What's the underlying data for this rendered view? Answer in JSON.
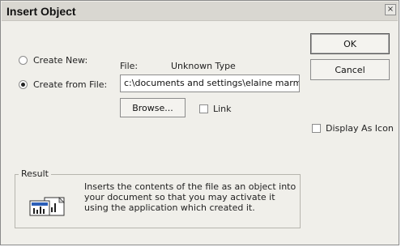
{
  "window": {
    "title": "Insert Object",
    "close_glyph": "×"
  },
  "options": {
    "create_new": {
      "label": "Create New:",
      "selected": false
    },
    "create_from_file": {
      "label": "Create from File:",
      "selected": true
    }
  },
  "file": {
    "label": "File:",
    "type_label": "Unknown Type",
    "path_value": "c:\\documents and settings\\elaine marm"
  },
  "buttons": {
    "ok": "OK",
    "cancel": "Cancel",
    "browse": "Browse..."
  },
  "checkboxes": {
    "link": {
      "label": "Link",
      "checked": false
    },
    "display_as_icon": {
      "label": "Display As Icon",
      "checked": false
    }
  },
  "result": {
    "legend": "Result",
    "text": "Inserts the contents of the file as an object into your document so that you may activate it using the application which created it.",
    "icon": "file-object-icon"
  }
}
